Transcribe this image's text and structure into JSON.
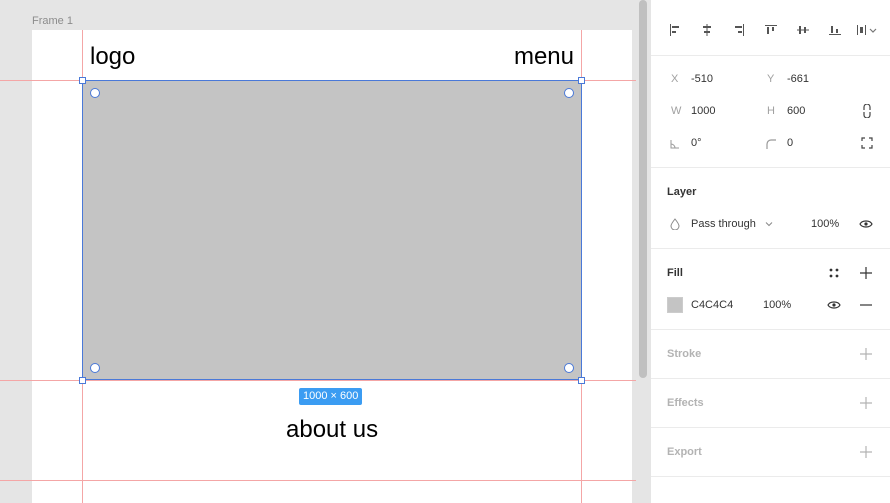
{
  "canvas": {
    "frame_label": "Frame 1",
    "logo_text": "logo",
    "menu_text": "menu",
    "about_text": "about us",
    "size_badge": "1000 × 600"
  },
  "panel": {
    "x_label": "X",
    "x_value": "-510",
    "y_label": "Y",
    "y_value": "-661",
    "w_label": "W",
    "w_value": "1000",
    "h_label": "H",
    "h_value": "600",
    "rotation_value": "0°",
    "radius_value": "0",
    "layer": {
      "title": "Layer",
      "blend_mode": "Pass through",
      "opacity": "100%"
    },
    "fill": {
      "title": "Fill",
      "hex": "C4C4C4",
      "opacity": "100%",
      "color": "#c4c4c4"
    },
    "stroke_title": "Stroke",
    "effects_title": "Effects",
    "export_title": "Export"
  },
  "colors": {
    "selection": "#4a79d8",
    "badge": "#3b9cf2",
    "guide": "#f4a6a6"
  }
}
